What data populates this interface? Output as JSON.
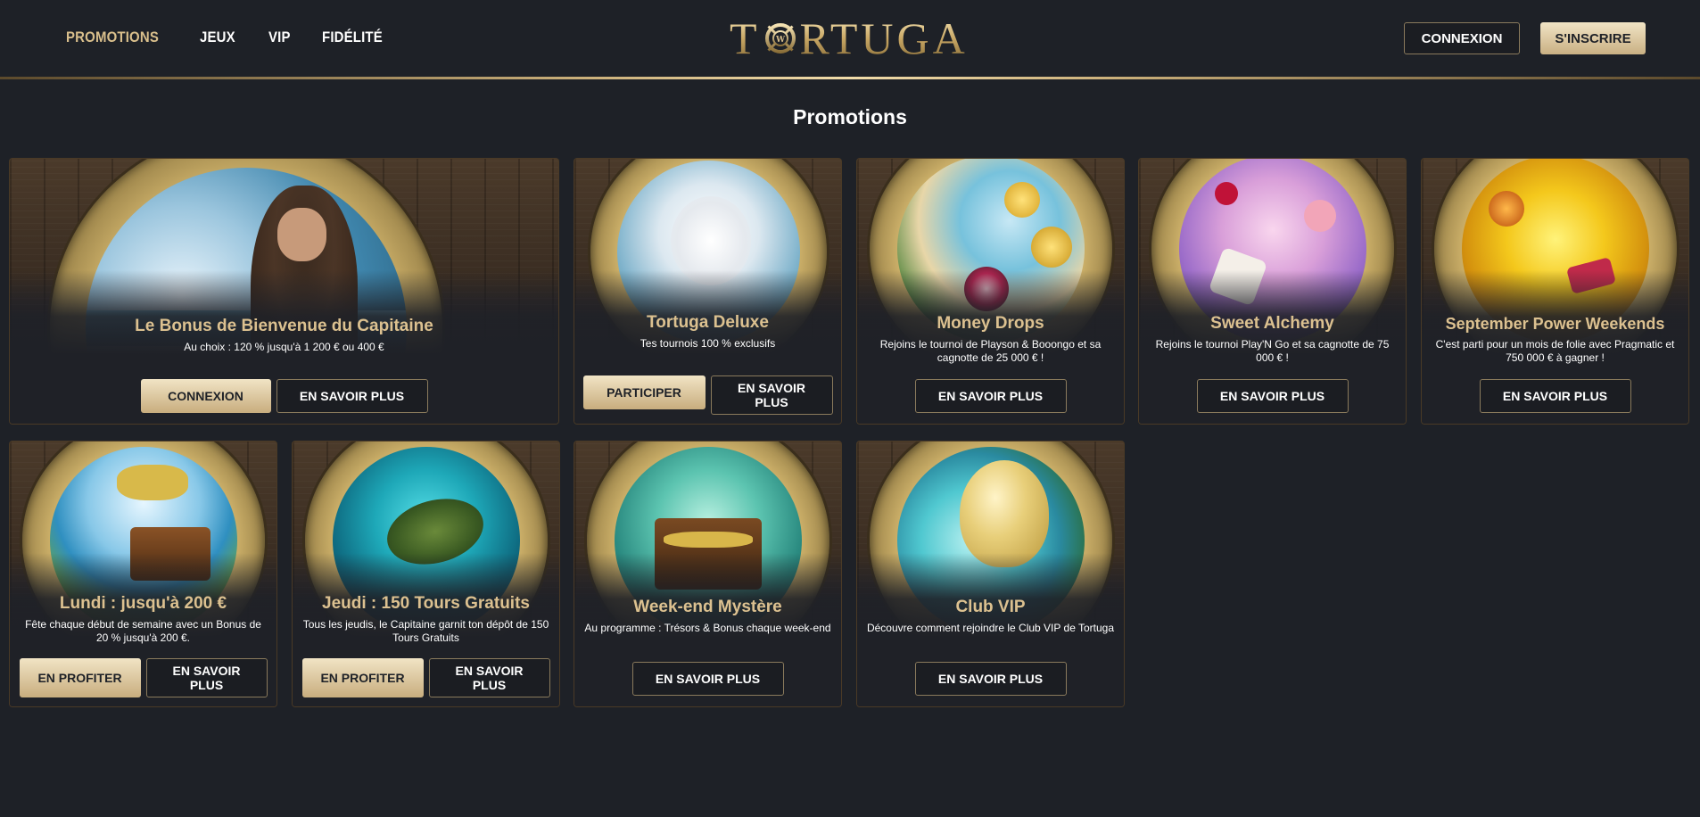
{
  "nav": {
    "items": [
      "PROMOTIONS",
      "JEUX",
      "VIP",
      "FIDÉLITÉ"
    ]
  },
  "logo": {
    "text_left": "T",
    "text_right": "RTUGA"
  },
  "header": {
    "login_label": "CONNEXION",
    "signup_label": "S'INSCRIRE"
  },
  "page": {
    "title": "Promotions"
  },
  "colors": {
    "accent_gold": "#dcc190",
    "background": "#1e2127",
    "button_gold": "#e6d4aa"
  },
  "cards": [
    {
      "title": "Le Bonus de Bienvenue du Capitaine",
      "desc": "Au choix : 120 % jusqu'à 1 200 € ou 400 €",
      "btn_primary": "CONNEXION",
      "btn_secondary": "EN SAVOIR PLUS",
      "scene": "pirate-sea"
    },
    {
      "title": "Tortuga Deluxe",
      "desc": "Tes tournois 100 % exclusifs",
      "btn_primary": "PARTICIPER",
      "btn_secondary": "EN SAVOIR PLUS",
      "scene": "pegasus"
    },
    {
      "title": "Money Drops",
      "desc": "Rejoins le tournoi de Playson & Booongo et sa cagnotte de 25 000 € !",
      "btn_secondary": "EN SAVOIR PLUS",
      "scene": "beach-coins"
    },
    {
      "title": "Sweet Alchemy",
      "desc": "Rejoins le tournoi Play'N Go et sa cagnotte de 75 000 € !",
      "btn_secondary": "EN SAVOIR PLUS",
      "scene": "candy-dice"
    },
    {
      "title": "September Power Weekends",
      "desc": "C'est parti pour un mois de folie avec Pragmatic et 750 000 € à gagner !",
      "btn_secondary": "EN SAVOIR PLUS",
      "scene": "gold-fire"
    },
    {
      "title": "Lundi : jusqu'à 200 €",
      "desc": "Fête chaque début de semaine avec un Bonus de 20 % jusqu'à 200 €.",
      "btn_primary": "EN PROFITER",
      "btn_secondary": "EN SAVOIR PLUS",
      "scene": "treasure-island"
    },
    {
      "title": "Jeudi : 150 Tours Gratuits",
      "desc": "Tous les jeudis, le Capitaine garnit ton dépôt de 150 Tours Gratuits",
      "btn_primary": "EN PROFITER",
      "btn_secondary": "EN SAVOIR PLUS",
      "scene": "sea-turtle"
    },
    {
      "title": "Week-end Mystère",
      "desc": "Au programme : Trésors & Bonus chaque week-end",
      "btn_secondary": "EN SAVOIR PLUS",
      "scene": "treasure-chest"
    },
    {
      "title": "Club VIP",
      "desc": "Découvre comment rejoindre le Club VIP de Tortuga",
      "btn_secondary": "EN SAVOIR PLUS",
      "scene": "golden-balloon"
    }
  ]
}
